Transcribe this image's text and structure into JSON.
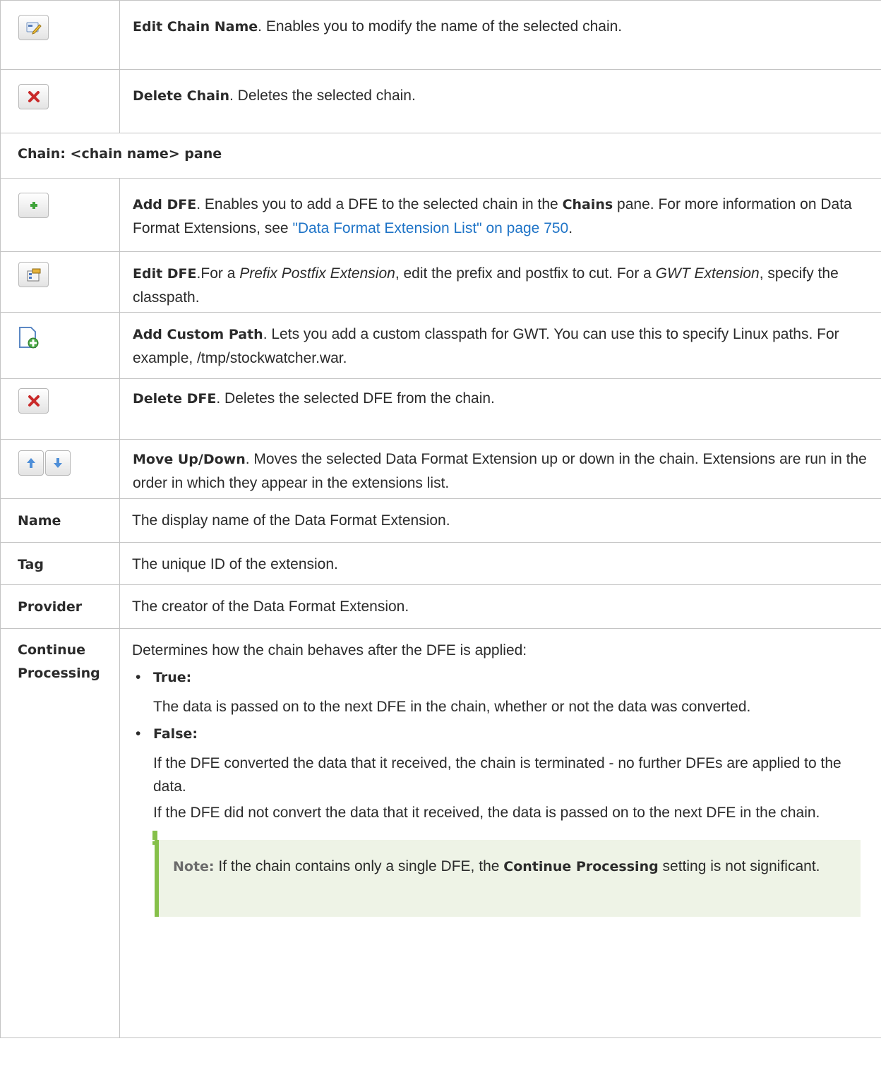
{
  "rows": {
    "edit_chain_name": {
      "title": "Edit Chain Name",
      "text": ". Enables you to modify the name of the selected chain."
    },
    "delete_chain": {
      "title": "Delete Chain",
      "text": ". Deletes the selected chain."
    },
    "section_title": "Chain: <chain name> pane",
    "add_dfe": {
      "title": "Add DFE",
      "text1": ". Enables you to add a DFE to the selected chain in the ",
      "bold": "Chains",
      "text2": " pane. For more information on Data Format Extensions, see ",
      "link": "\"Data Format Extension List\" on page 750",
      "text3": "."
    },
    "edit_dfe": {
      "title": "Edit DFE",
      "text1": ".For a ",
      "italic1": "Prefix Postfix Extension",
      "text2": ", edit the prefix and postfix to cut. For a ",
      "italic2": "GWT Extension",
      "text3": ", specify the classpath."
    },
    "add_custom_path": {
      "title": "Add Custom Path",
      "text": ". Lets you add a custom classpath for GWT. You can use this to specify Linux paths. For example, /tmp/stockwatcher.war."
    },
    "delete_dfe": {
      "title": "Delete DFE",
      "text": ". Deletes the selected DFE from the chain."
    },
    "move_up_down": {
      "title": "Move Up/Down",
      "text": ". Moves the selected Data Format Extension up or down in the chain. Extensions are run in the order in which they appear in the extensions list."
    },
    "name": {
      "label": "Name",
      "text": "The display name of the Data Format Extension."
    },
    "tag": {
      "label": "Tag",
      "text": "The unique ID of the extension."
    },
    "provider": {
      "label": "Provider",
      "text": "The creator of the Data Format Extension."
    },
    "continue_processing": {
      "label1": "Continue",
      "label2": "Processing",
      "intro": "Determines how the chain behaves after the DFE is applied:",
      "true_label": "True:",
      "true_text": "The data is passed on to the next DFE in the chain, whether or not the data was converted.",
      "false_label": "False:",
      "false_text1": "If the DFE converted the data that it received, the chain is terminated - no further DFEs are applied to the data.",
      "false_text2": "If the DFE did not convert the data that it received, the data is passed on to the next DFE in the chain.",
      "note_label": "Note:",
      "note_text1": " If the chain contains only a single DFE, the ",
      "note_bold": "Continue Processing",
      "note_text2": " setting is not significant."
    }
  },
  "icons": {
    "edit": "edit-icon",
    "delete": "delete-icon",
    "add": "add-icon",
    "properties": "properties-icon",
    "add_path": "add-path-icon",
    "up": "arrow-up-icon",
    "down": "arrow-down-icon"
  },
  "colors": {
    "link": "#1f74c7",
    "note_bg": "#eef3e6",
    "note_bar": "#86c04a",
    "border": "#c4c4c4"
  }
}
